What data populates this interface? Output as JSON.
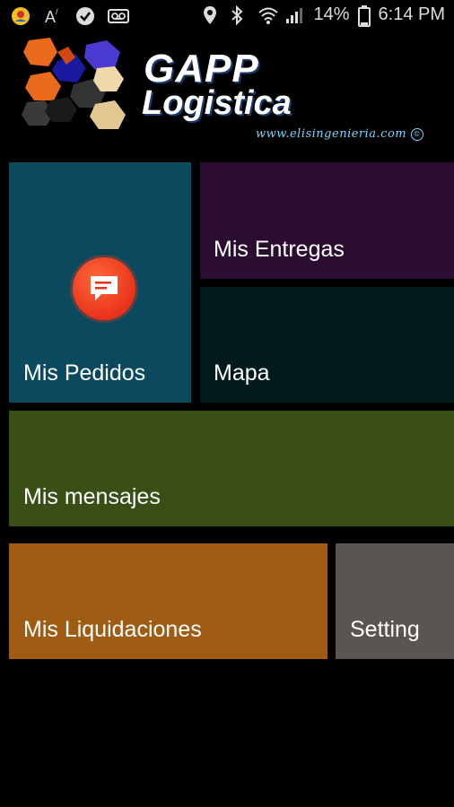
{
  "status_bar": {
    "battery_percent": "14%",
    "time": "6:14 PM",
    "icons_left": [
      "notification-app-icon",
      "font-a-icon",
      "check-circle-icon",
      "voicemail-icon"
    ],
    "icons_right": [
      "location-pin-icon",
      "bluetooth-icon",
      "wifi-icon",
      "signal-bars-icon",
      "battery-icon"
    ]
  },
  "header": {
    "brand_line1": "GAPP",
    "brand_line2": "Logistica",
    "website": "www.elisingenieria.com"
  },
  "tiles": {
    "pedidos": {
      "label": "Mis Pedidos",
      "color": "#0b4a5e",
      "icon": "chat-message-icon"
    },
    "entregas": {
      "label": "Mis Entregas",
      "color": "#2a0d30"
    },
    "mapa": {
      "label": "Mapa",
      "color": "#031b1d"
    },
    "mensajes": {
      "label": "Mis mensajes",
      "color": "#3a4f16"
    },
    "liquidaciones": {
      "label": "Mis Liquidaciones",
      "color": "#a05c12"
    },
    "setting": {
      "label": "Setting",
      "color": "#5a5550"
    }
  }
}
